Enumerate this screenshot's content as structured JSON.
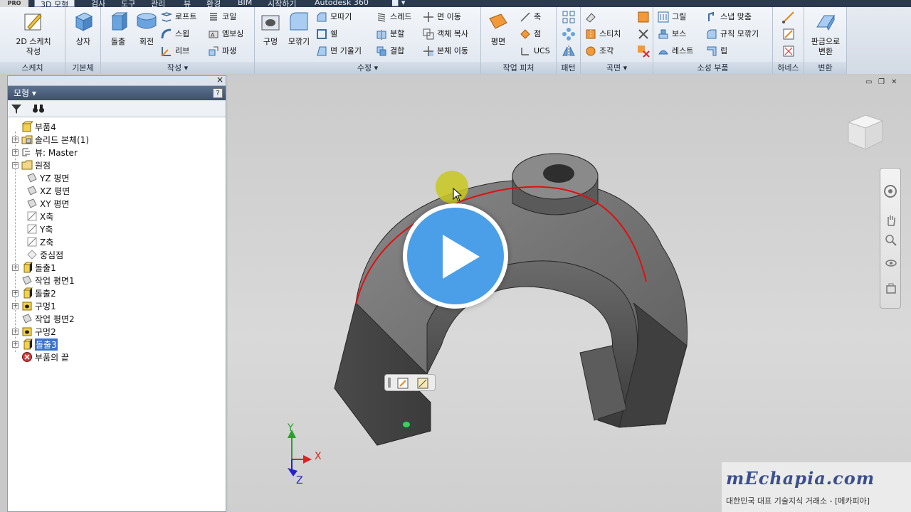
{
  "menu": {
    "pro_badge": "PRO",
    "tabs": [
      "3D 모형",
      "검사",
      "도구",
      "관리",
      "뷰",
      "환경",
      "BIM",
      "시작하기",
      "Autodesk 360"
    ]
  },
  "ribbon": {
    "sketch": {
      "footer": "스케치",
      "create_2d_sketch": "2D 스케치",
      "create_2d_sketch_line2": "작성"
    },
    "primitives": {
      "footer": "기본체",
      "box": "상자"
    },
    "create": {
      "footer": "작성 ▾",
      "extrude": "돌출",
      "revolve": "회전",
      "loft": "로프트",
      "sweep": "스윕",
      "rib": "리브",
      "coil": "코일",
      "emboss": "엠보싱",
      "derive": "파생"
    },
    "modify": {
      "footer": "수정 ▾",
      "hole": "구멍",
      "fillet": "모깎기",
      "chamfer": "모따기",
      "shell": "쉘",
      "face_draft": "면 기울기",
      "thread": "스레드",
      "split": "분할",
      "combine": "결합",
      "move_face": "면 이동",
      "copy_object": "객체 복사",
      "move_bodies": "본체 이동"
    },
    "work_features": {
      "footer": "작업 피처",
      "plane": "평면",
      "axis": "축",
      "point": "점",
      "ucs": "UCS"
    },
    "pattern": {
      "footer": "패턴"
    },
    "surface": {
      "footer": "곡면 ▾",
      "stitch": "스티치",
      "sculpt": "조각"
    },
    "plastic_part": {
      "footer": "소성 부품",
      "grill": "그릴",
      "boss": "보스",
      "rest": "레스트",
      "snap_fit": "스냅 맞춤",
      "rule_fillet": "규칙 모깎기",
      "lip": "립"
    },
    "harness": {
      "footer": "하네스"
    },
    "convert": {
      "footer": "변환",
      "convert_to_sheet_metal": "판금으로",
      "convert_to_sheet_metal_line2": "변환"
    }
  },
  "browser": {
    "title": "모형 ▾",
    "help": "?",
    "close": "×",
    "tree": [
      {
        "label": "부품4",
        "level": 0,
        "expander": "",
        "icon": "part-icon"
      },
      {
        "label": "솔리드 본체(1)",
        "level": 0,
        "expander": "+",
        "icon": "solid-bodies-icon"
      },
      {
        "label": "뷰: Master",
        "level": 0,
        "expander": "+",
        "icon": "view-icon"
      },
      {
        "label": "원점",
        "level": 0,
        "expander": "−",
        "icon": "origin-folder-icon"
      },
      {
        "label": "YZ 평면",
        "level": 1,
        "expander": "",
        "icon": "plane-icon"
      },
      {
        "label": "XZ 평면",
        "level": 1,
        "expander": "",
        "icon": "plane-icon"
      },
      {
        "label": "XY 평면",
        "level": 1,
        "expander": "",
        "icon": "plane-icon"
      },
      {
        "label": "X축",
        "level": 1,
        "expander": "",
        "icon": "axis-icon"
      },
      {
        "label": "Y축",
        "level": 1,
        "expander": "",
        "icon": "axis-icon"
      },
      {
        "label": "Z축",
        "level": 1,
        "expander": "",
        "icon": "axis-icon"
      },
      {
        "label": "중심점",
        "level": 1,
        "expander": "",
        "icon": "center-point-icon"
      },
      {
        "label": "돌출1",
        "level": 0,
        "expander": "+",
        "icon": "extrude-icon"
      },
      {
        "label": "작업 평면1",
        "level": 0,
        "expander": "",
        "icon": "work-plane-icon"
      },
      {
        "label": "돌출2",
        "level": 0,
        "expander": "+",
        "icon": "extrude-icon"
      },
      {
        "label": "구멍1",
        "level": 0,
        "expander": "+",
        "icon": "hole-icon"
      },
      {
        "label": "작업 평면2",
        "level": 0,
        "expander": "",
        "icon": "work-plane-icon"
      },
      {
        "label": "구멍2",
        "level": 0,
        "expander": "+",
        "icon": "hole-icon"
      },
      {
        "label": "돌출3",
        "level": 0,
        "expander": "+",
        "icon": "extrude-icon",
        "selected": true
      },
      {
        "label": "부품의 끝",
        "level": 0,
        "expander": "",
        "icon": "end-of-part-icon"
      }
    ]
  },
  "viewport": {
    "axis_x": "X",
    "axis_y": "Y",
    "axis_z": "Z",
    "watermark_logo": "mEchapia.com",
    "watermark_sub": "대한민국 대표 기술지식 거래소 - [메카피아]"
  },
  "colors": {
    "accent": "#3a74c9",
    "play": "#4a9fe8",
    "cursor_highlight": "#c8c81e",
    "sketch_line": "#e01010"
  }
}
